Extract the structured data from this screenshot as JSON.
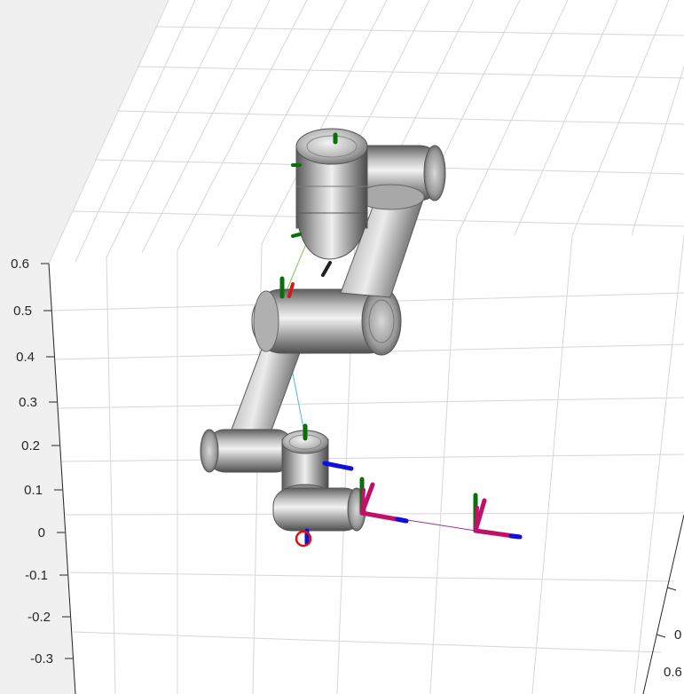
{
  "window": {
    "background": "#f0f0f0",
    "plot_face": "#ffffff",
    "grid_color": "#d7d7d7",
    "axis_color": "#262626"
  },
  "axes3d": {
    "z_axis": {
      "tick_labels": [
        "0.6",
        "0.5",
        "0.4",
        "0.3",
        "0.2",
        "0.1",
        "0",
        "-0.1",
        "-0.2",
        "-0.3"
      ]
    },
    "y_axis": {
      "tick_labels": [
        "0",
        "0.6"
      ]
    }
  },
  "robot": {
    "link_color": "#9a9a9a",
    "link_highlight": "#e0e0e0",
    "joint_ring_color": "#c2c2c2",
    "frame_colors": {
      "x": "#1010dd",
      "y": "#0a6e0a",
      "z": "#c0106a",
      "axis_red": "#d11a1a"
    },
    "connector_colors": [
      "#7ec850",
      "#4db6e3",
      "#9b30a6"
    ],
    "base_marker_color": "#e01010"
  }
}
